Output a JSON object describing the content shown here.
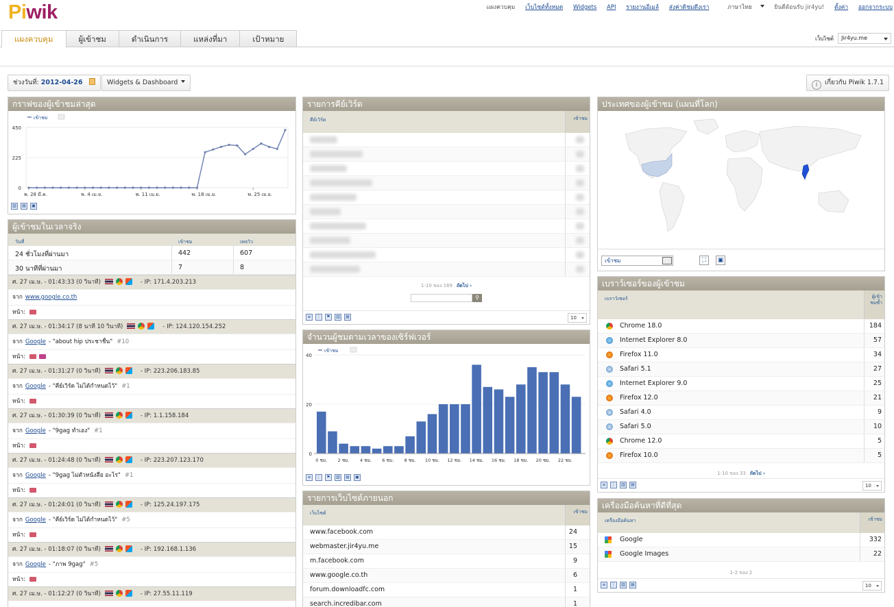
{
  "header": {
    "logo": "Piwik",
    "nav": [
      "แผงควบคุม",
      "เว็บไซต์ทั้งหมด",
      "Widgets",
      "API",
      "รายงานอีเมล์",
      "ส่งค่าดิชมดึงเรา",
      "ภาษาไทย"
    ],
    "welcome": "ยินดีต้อนรับ jir4yu!",
    "settings": "ตั้งค่า",
    "logout": "ออกจากระบบ",
    "site_label": "เว็บไซต์",
    "site_value": "Jir4yu.me"
  },
  "tabs": [
    "แผงควบคุม",
    "ผู้เข้าชม",
    "ดำเนินการ",
    "แหล่งที่มา",
    "เป้าหมาย"
  ],
  "controls": {
    "date_label": "ช่วงวันที่:",
    "date_value": "2012-04-26",
    "widgets_label": "Widgets & Dashboard",
    "about_label": "เกี่ยวกับ Piwik 1.7.1"
  },
  "visits_graph": {
    "title": "กราฟของผู้เข้าชมล่าสุด",
    "legend": "เข้าชม",
    "chart_data": {
      "type": "line",
      "series": [
        {
          "name": "เข้าชม",
          "values": [
            0,
            0,
            0,
            0,
            0,
            0,
            0,
            0,
            0,
            0,
            0,
            0,
            0,
            0,
            0,
            0,
            0,
            0,
            0,
            0,
            0,
            0,
            265,
            285,
            305,
            320,
            315,
            250,
            290,
            330,
            305,
            290,
            430
          ]
        }
      ],
      "x_ticks": [
        "พ. 28 มี.ค.",
        "พ. 4 เม.ย.",
        "พ. 11 เม.ย.",
        "พ. 18 เม.ย.",
        "พ. 25 เม.ย."
      ],
      "y_ticks": [
        "450",
        "225",
        "0"
      ],
      "ylim": [
        0,
        450
      ]
    }
  },
  "realtime": {
    "title": "ผู้เข้าชมในเวลาจริง",
    "headers": [
      "วันที่",
      "เข้าชม",
      "เพจวิว"
    ],
    "rows": [
      {
        "label": "24 ชั่วโมงที่ผ่านมา",
        "visits": "442",
        "pageviews": "607"
      },
      {
        "label": "30 นาทีที่ผ่านมา",
        "visits": "7",
        "pageviews": "8"
      }
    ],
    "visits": [
      {
        "time": "ศ. 27 เม.ษ. - 01:43:33 (0 วินาที)",
        "ip": "- IP: 171.4.203.213",
        "from_prefix": "จาก",
        "source": "www.google.co.th",
        "keyword": "",
        "rank": "",
        "pages_label": "หน้า:"
      },
      {
        "time": "ศ. 27 เม.ษ. - 01:34:17 (8 นาที 10 วินาที)",
        "ip": "- IP: 124.120.154.252",
        "from_prefix": "จาก",
        "source": "Google",
        "keyword": "- \"about hip ประชาชื่น\"",
        "rank": "#10",
        "pages_label": "หน้า:"
      },
      {
        "time": "ศ. 27 เม.ษ. - 01:31:27 (0 วินาที)",
        "ip": "- IP: 223.206.183.85",
        "from_prefix": "จาก",
        "source": "Google",
        "keyword": "- \"คีย์เวิร์ด ไม่ได้กำหนดไว้\"",
        "rank": "#1",
        "pages_label": "หน้า:"
      },
      {
        "time": "ศ. 27 เม.ษ. - 01:30:39 (0 วินาที)",
        "ip": "- IP: 1.1.158.184",
        "from_prefix": "จาก",
        "source": "Google",
        "keyword": "- \"9gag ทำเอง\"",
        "rank": "#1",
        "pages_label": "หน้า:"
      },
      {
        "time": "ศ. 27 เม.ษ. - 01:24:48 (0 วินาที)",
        "ip": "- IP: 223.207.123.170",
        "from_prefix": "จาก",
        "source": "Google",
        "keyword": "- \"9gag ไม่ตัวหนังสือ อะไร\"",
        "rank": "#1",
        "pages_label": "หน้า:"
      },
      {
        "time": "ศ. 27 เม.ษ. - 01:24:01 (0 วินาที)",
        "ip": "- IP: 125.24.197.175",
        "from_prefix": "จาก",
        "source": "Google",
        "keyword": "- \"คีย์เวิร์ด ไม่ได้กำหนดไว้\"",
        "rank": "#5",
        "pages_label": "หน้า:"
      },
      {
        "time": "ศ. 27 เม.ษ. - 01:18:07 (0 วินาที)",
        "ip": "- IP: 192.168.1.136",
        "from_prefix": "จาก",
        "source": "Google",
        "keyword": "- \"ภาพ 9gag\"",
        "rank": "#5",
        "pages_label": "หน้า:"
      },
      {
        "time": "ศ. 27 เม.ษ. - 01:12:27 (0 วินาที)",
        "ip": "- IP: 27.55.11.119",
        "from_prefix": "",
        "source": "",
        "keyword": "",
        "rank": "",
        "pages_label": ""
      }
    ]
  },
  "keywords": {
    "title": "รายการคีย์เวิร์ด",
    "col_label": "คีย์เวิร์ด",
    "col_value": "เข้าชม",
    "pager": "1-10 ของ 169",
    "next": "ถัดไป ›",
    "limit": "10"
  },
  "server_time": {
    "title": "จำนวนผู้ชมตามเวลาของเซิร์ฟเวอร์",
    "legend": "เข้าชม",
    "chart_data": {
      "type": "bar",
      "categories": [
        "0 ชม.",
        "1 ชม.",
        "2 ชม.",
        "3 ชม.",
        "4 ชม.",
        "5 ชม.",
        "6 ชม.",
        "7 ชม.",
        "8 ชม.",
        "9 ชม.",
        "10 ชม.",
        "11 ชม.",
        "12 ชม.",
        "13 ชม.",
        "14 ชม.",
        "15 ชม.",
        "16 ชม.",
        "17 ชม.",
        "18 ชม.",
        "19 ชม.",
        "20 ชม.",
        "21 ชม.",
        "22 ชม.",
        "23 ชม."
      ],
      "values": [
        17,
        9,
        4,
        3,
        3,
        2,
        3,
        3,
        7,
        13,
        16,
        20,
        20,
        20,
        36,
        27,
        26,
        23,
        28,
        35,
        33,
        33,
        28,
        23
      ],
      "tick_labels": [
        "0 ชม.",
        "2 ชม.",
        "4 ชม.",
        "6 ชม.",
        "8 ชม.",
        "10 ชม.",
        "12 ชม.",
        "14 ชม.",
        "16 ชม.",
        "18 ชม.",
        "20 ชม.",
        "22 ชม."
      ],
      "y_ticks": [
        "40",
        "20",
        "0"
      ],
      "ylim": [
        0,
        40
      ]
    }
  },
  "websites": {
    "title": "รายการเว็บไซต์ภายนอก",
    "col_label": "เว็บไซต์",
    "col_value": "เข้าชม",
    "rows": [
      {
        "label": "www.facebook.com",
        "value": "24"
      },
      {
        "label": "webmaster.jir4yu.me",
        "value": "15"
      },
      {
        "label": "m.facebook.com",
        "value": "9"
      },
      {
        "label": "www.google.co.th",
        "value": "6"
      },
      {
        "label": "forum.downloadfc.com",
        "value": "1"
      },
      {
        "label": "search.incredibar.com",
        "value": "1"
      }
    ]
  },
  "map": {
    "title": "ประเทศของผู้เข้าชม (แผนที่โลก)",
    "metric": "เข้าชม"
  },
  "browsers": {
    "title": "เบราว์เซอร์ของผู้เข้าชม",
    "col_label": "เบราว์เซอร์",
    "col_value": "ผู้เข้าชมซ้ำ",
    "rows": [
      {
        "label": "Chrome 18.0",
        "value": "184",
        "icon": "chrome"
      },
      {
        "label": "Internet Explorer 8.0",
        "value": "57",
        "icon": "ie"
      },
      {
        "label": "Firefox 11.0",
        "value": "34",
        "icon": "firefox"
      },
      {
        "label": "Safari 5.1",
        "value": "27",
        "icon": "safari"
      },
      {
        "label": "Internet Explorer 9.0",
        "value": "25",
        "icon": "ie"
      },
      {
        "label": "Firefox 12.0",
        "value": "21",
        "icon": "firefox"
      },
      {
        "label": "Safari 4.0",
        "value": "9",
        "icon": "safari"
      },
      {
        "label": "Safari 5.0",
        "value": "10",
        "icon": "safari"
      },
      {
        "label": "Chrome 12.0",
        "value": "5",
        "icon": "chrome"
      },
      {
        "label": "Firefox 10.0",
        "value": "5",
        "icon": "firefox"
      }
    ],
    "pager": "1-10 ของ 33",
    "next": "ถัดไป ›",
    "limit": "10"
  },
  "search_engines": {
    "title": "เครื่องมือค้นหาที่ดีที่สุด",
    "col_label": "เครื่องมือค้นหา",
    "col_value": "เข้าชม",
    "rows": [
      {
        "label": "Google",
        "value": "332"
      },
      {
        "label": "Google Images",
        "value": "22"
      }
    ],
    "pager": "1-2 ของ 2",
    "limit": "10"
  },
  "colors": {
    "bar": "#4a6fb5",
    "line": "#6c7fb0",
    "header": "#a9a497",
    "highlight": "#c78c0f"
  }
}
